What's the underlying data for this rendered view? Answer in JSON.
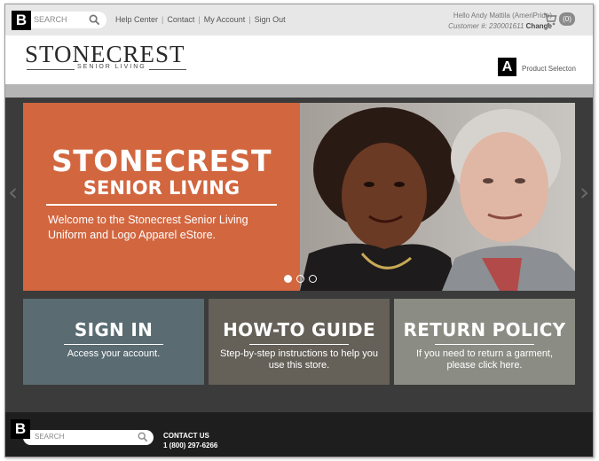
{
  "markers": {
    "top_left": "B",
    "header_right": "A",
    "footer_left": "B"
  },
  "topbar": {
    "search_placeholder": "SEARCH",
    "links": [
      "Help Center",
      "Contact",
      "My Account",
      "Sign Out"
    ],
    "separator": "|",
    "greeting": "Hello Andy Mattila (AmeriPride)",
    "customer_label": "Customer #: 230001611",
    "change_label": "Change",
    "cart_count": "(0)",
    "icons": {
      "search": "search-icon",
      "cart": "cart-icon"
    }
  },
  "header": {
    "logo_main": "STONECREST",
    "logo_sub": "SENIOR LIVING",
    "product_selection": "Product Selecton"
  },
  "hero": {
    "title_line1": "STONECREST",
    "title_line2": "SENIOR LIVING",
    "welcome": "Welcome to the Stonecrest Senior Living Uniform and Logo Apparel eStore.",
    "prev_arrow": "‹",
    "next_arrow": "›",
    "slide_count": 3,
    "active_slide": 1,
    "background_color": "#d2663f"
  },
  "cards": [
    {
      "title": "SIGN IN",
      "description": "Access your account.",
      "color": "#5a6b72"
    },
    {
      "title": "HOW-TO GUIDE",
      "description": "Step-by-step instructions to help you use this store.",
      "color": "#656058"
    },
    {
      "title": "RETURN POLICY",
      "description": "If you need to return a garment, please click here.",
      "color": "#8b8c84"
    }
  ],
  "footer": {
    "search_placeholder": "SEARCH",
    "contact_title": "CONTACT US",
    "contact_phone": "1 (800) 297-6266"
  }
}
